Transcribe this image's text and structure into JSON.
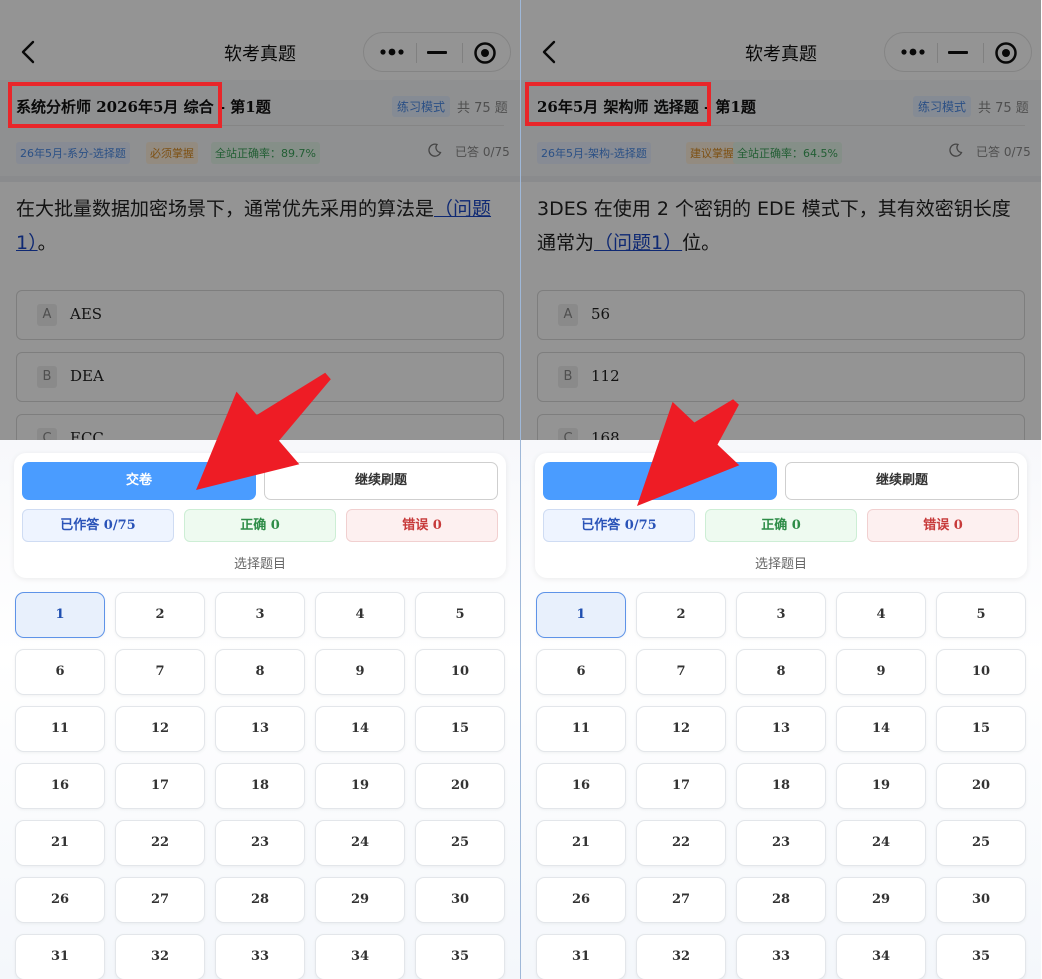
{
  "panels": [
    {
      "nav_title": "软考真题",
      "exam_title": "系统分析师 2026年5月 综合 - 第1题",
      "mode_tag": "练习模式",
      "total": "共 75 题",
      "tags": [
        "26年5月-系分-选择题",
        "必须掌握",
        "全站正确率：89.7%"
      ],
      "answered_top": "已答 0/75",
      "question_before": "在大批量数据加密场景下，通常优先采用的算法是",
      "question_blank": "（问题1）",
      "question_after": "。",
      "options": [
        {
          "letter": "A",
          "text": "AES"
        },
        {
          "letter": "B",
          "text": "DEA"
        },
        {
          "letter": "C",
          "text": "ECC"
        }
      ],
      "submit_label": "交卷",
      "continue_label": "继续刷题",
      "stat_done": "已作答 0/75",
      "stat_right": "正确 0",
      "stat_wrong": "错误 0",
      "pick_label": "选择题目",
      "numbers": [
        "1",
        "2",
        "3",
        "4",
        "5",
        "6",
        "7",
        "8",
        "9",
        "10",
        "11",
        "12",
        "13",
        "14",
        "15",
        "16",
        "17",
        "18",
        "19",
        "20",
        "21",
        "22",
        "23",
        "24",
        "25",
        "26",
        "27",
        "28",
        "29",
        "30",
        "31",
        "32",
        "33",
        "34",
        "35"
      ]
    },
    {
      "nav_title": "软考真题",
      "exam_title": "26年5月 架构师 选择题 - 第1题",
      "mode_tag": "练习模式",
      "total": "共 75 题",
      "tags": [
        "26年5月-架构-选择题",
        "建议掌握",
        "全站正确率：64.5%"
      ],
      "answered_top": "已答 0/75",
      "question_before": "3DES 在使用 2 个密钥的 EDE 模式下，其有效密钥长度通常为",
      "question_blank": "（问题1）",
      "question_after": "位。",
      "options": [
        {
          "letter": "A",
          "text": "56"
        },
        {
          "letter": "B",
          "text": "112"
        },
        {
          "letter": "C",
          "text": "168"
        }
      ],
      "submit_label": "",
      "continue_label": "继续刷题",
      "stat_done": "已作答 0/75",
      "stat_right": "正确 0",
      "stat_wrong": "错误 0",
      "pick_label": "选择题目",
      "numbers": [
        "1",
        "2",
        "3",
        "4",
        "5",
        "6",
        "7",
        "8",
        "9",
        "10",
        "11",
        "12",
        "13",
        "14",
        "15",
        "16",
        "17",
        "18",
        "19",
        "20",
        "21",
        "22",
        "23",
        "24",
        "25",
        "26",
        "27",
        "28",
        "29",
        "30",
        "31",
        "32",
        "33",
        "34",
        "35"
      ]
    }
  ],
  "icons": {
    "back": "chevron-left-icon",
    "more": "more-dots-icon",
    "minimize": "minimize-icon",
    "close": "target-circle-icon",
    "theme": "moon-icon",
    "annotation": "red-arrow-annotation"
  },
  "colors": {
    "primary": "#4a9cff",
    "highlight": "#e8262a",
    "link": "#1a47c7"
  }
}
